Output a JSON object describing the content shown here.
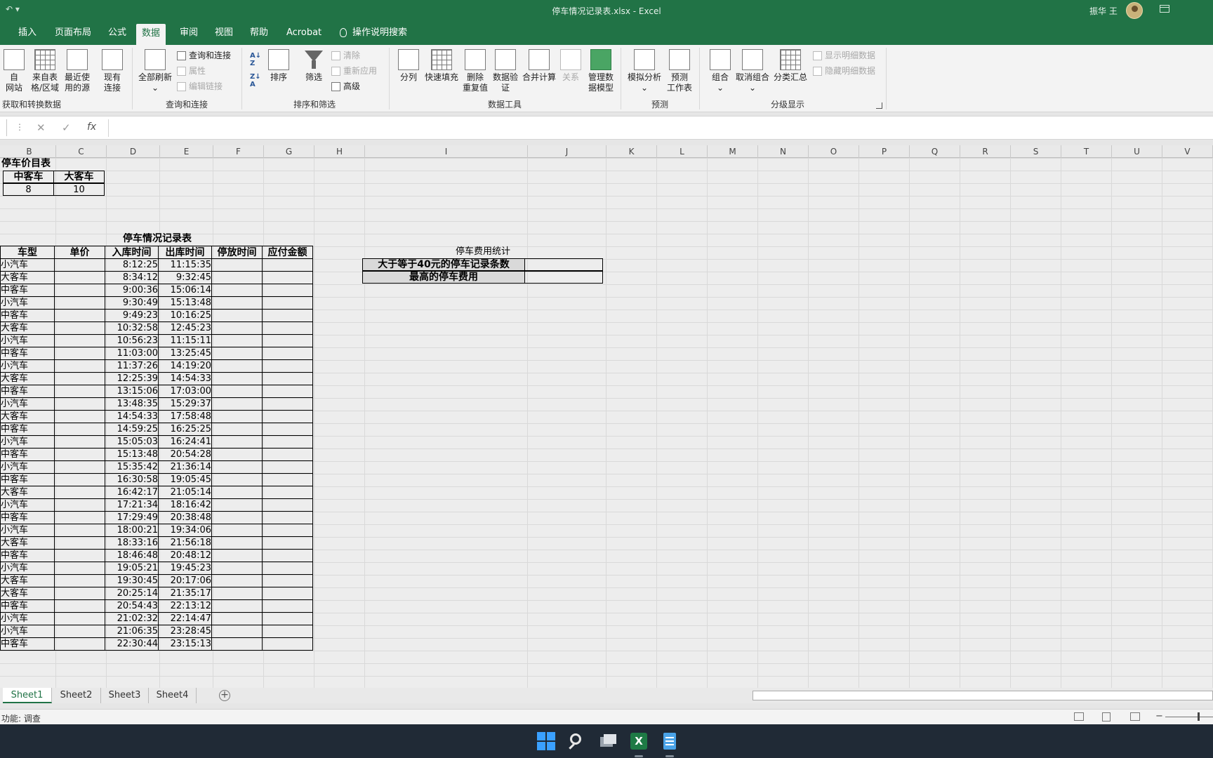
{
  "titlebar": {
    "quick_access": "↶ ▾",
    "title": "停车情况记录表.xlsx  -  Excel",
    "user": "振华 王"
  },
  "tabs": [
    "插入",
    "页面布局",
    "公式",
    "数据",
    "审阅",
    "视图",
    "帮助",
    "Acrobat"
  ],
  "tell_me": "操作说明搜索",
  "ribbon": {
    "get": {
      "from_web": "自\n网站",
      "from_table": "来自表\n格/区域",
      "recent": "最近使\n用的源",
      "existing": "现有\n连接",
      "group": "获取和转换数据"
    },
    "queries": {
      "refresh_all": "全部刷新",
      "queries_conn": "查询和连接",
      "props": "属性",
      "edit_links": "编辑链接",
      "group": "查询和连接"
    },
    "sort": {
      "sort": "排序",
      "filter": "筛选",
      "clear": "清除",
      "reapply": "重新应用",
      "advanced": "高级",
      "group": "排序和筛选"
    },
    "tools": {
      "split": "分列",
      "flash": "快速填充",
      "remove_dup": "删除\n重复值",
      "validate": "数据验\n证",
      "consolidate": "合并计算",
      "relations": "关系",
      "model": "管理数\n据模型",
      "group": "数据工具"
    },
    "forecast": {
      "whatif": "模拟分析",
      "sheet": "预测\n工作表",
      "group": "预测"
    },
    "outline": {
      "group_btn": "组合",
      "ungroup": "取消组合",
      "subtotal": "分类汇总",
      "show": "显示明细数据",
      "hide": "隐藏明细数据",
      "group": "分级显示"
    }
  },
  "formula": {
    "cancel": "✕",
    "enter": "✓",
    "fx": "fx",
    "value": ""
  },
  "columns": [
    "B",
    "C",
    "D",
    "E",
    "F",
    "G",
    "H",
    "I",
    "J",
    "K",
    "L",
    "M",
    "N",
    "O",
    "P",
    "Q",
    "R",
    "S",
    "T",
    "U",
    "V"
  ],
  "price_table": {
    "title": "停车价目表",
    "headers": [
      "中客车",
      "大客车"
    ],
    "values": [
      "8",
      "10"
    ]
  },
  "record_table": {
    "title": "停车情况记录表",
    "headers": [
      "车型",
      "单价",
      "入库时间",
      "出库时间",
      "停放时间",
      "应付金额"
    ],
    "rows": [
      [
        "小汽车",
        "8:12:25",
        "11:15:35"
      ],
      [
        "大客车",
        "8:34:12",
        "9:32:45"
      ],
      [
        "中客车",
        "9:00:36",
        "15:06:14"
      ],
      [
        "小汽车",
        "9:30:49",
        "15:13:48"
      ],
      [
        "中客车",
        "9:49:23",
        "10:16:25"
      ],
      [
        "大客车",
        "10:32:58",
        "12:45:23"
      ],
      [
        "小汽车",
        "10:56:23",
        "11:15:11"
      ],
      [
        "中客车",
        "11:03:00",
        "13:25:45"
      ],
      [
        "小汽车",
        "11:37:26",
        "14:19:20"
      ],
      [
        "大客车",
        "12:25:39",
        "14:54:33"
      ],
      [
        "中客车",
        "13:15:06",
        "17:03:00"
      ],
      [
        "小汽车",
        "13:48:35",
        "15:29:37"
      ],
      [
        "大客车",
        "14:54:33",
        "17:58:48"
      ],
      [
        "中客车",
        "14:59:25",
        "16:25:25"
      ],
      [
        "小汽车",
        "15:05:03",
        "16:24:41"
      ],
      [
        "中客车",
        "15:13:48",
        "20:54:28"
      ],
      [
        "小汽车",
        "15:35:42",
        "21:36:14"
      ],
      [
        "中客车",
        "16:30:58",
        "19:05:45"
      ],
      [
        "大客车",
        "16:42:17",
        "21:05:14"
      ],
      [
        "小汽车",
        "17:21:34",
        "18:16:42"
      ],
      [
        "中客车",
        "17:29:49",
        "20:38:48"
      ],
      [
        "小汽车",
        "18:00:21",
        "19:34:06"
      ],
      [
        "大客车",
        "18:33:16",
        "21:56:18"
      ],
      [
        "中客车",
        "18:46:48",
        "20:48:12"
      ],
      [
        "小汽车",
        "19:05:21",
        "19:45:23"
      ],
      [
        "大客车",
        "19:30:45",
        "20:17:06"
      ],
      [
        "大客车",
        "20:25:14",
        "21:35:17"
      ],
      [
        "中客车",
        "20:54:43",
        "22:13:12"
      ],
      [
        "小汽车",
        "21:02:32",
        "22:14:47"
      ],
      [
        "小汽车",
        "21:06:35",
        "23:28:45"
      ],
      [
        "中客车",
        "22:30:44",
        "23:15:13"
      ]
    ]
  },
  "stats": {
    "title": "停车费用统计",
    "row1": "大于等于40元的停车记录条数",
    "row2": "最高的停车费用"
  },
  "sheets": [
    "Sheet1",
    "Sheet2",
    "Sheet3",
    "Sheet4"
  ],
  "status": {
    "mode": "功能: 调查"
  },
  "colors": {
    "excel_green": "#217346"
  }
}
